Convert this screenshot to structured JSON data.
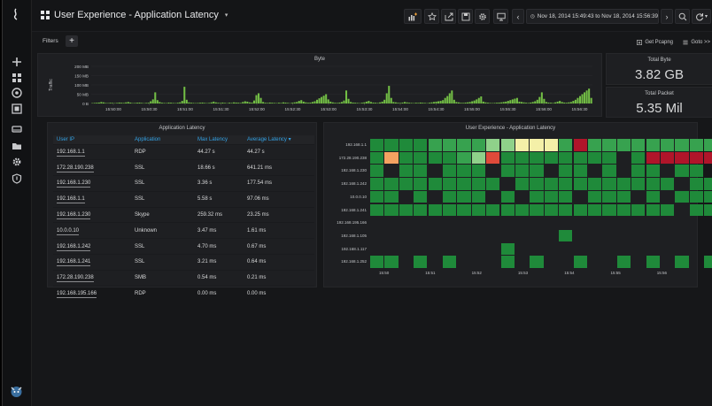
{
  "header": {
    "title": "User Experience - Application Latency",
    "time_range": "Nov 18, 2014 15:49:43 to Nov 18, 2014 15:56:39"
  },
  "filters": {
    "label": "Filters",
    "add_label": "+"
  },
  "actions": {
    "pcap_label": "Get Pcapng",
    "goto_label": "Goto >>"
  },
  "byte_panel": {
    "title": "Byte",
    "y_axis_label": "Traffic",
    "y_ticks": [
      "200 MB",
      "150 MB",
      "100 MB",
      "50 MB",
      "0 B"
    ],
    "x_ticks": [
      "15:50:00",
      "15:50:30",
      "15:51:00",
      "15:51:30",
      "15:52:00",
      "15:52:30",
      "15:53:00",
      "15:53:30",
      "15:54:00",
      "15:54:30",
      "15:55:00",
      "15:55:30",
      "15:56:00",
      "15:56:30"
    ]
  },
  "chart_data": {
    "type": "bar",
    "title": "Byte",
    "ylabel": "Traffic",
    "ylim": [
      0,
      200
    ],
    "unit": "MB",
    "x_range": [
      "15:49:43",
      "15:56:39"
    ],
    "values": [
      2,
      3,
      4,
      5,
      8,
      6,
      3,
      2,
      4,
      3,
      2,
      3,
      5,
      4,
      3,
      6,
      8,
      5,
      2,
      3,
      4,
      5,
      3,
      2,
      3,
      4,
      12,
      22,
      60,
      18,
      8,
      4,
      3,
      2,
      5,
      4,
      3,
      2,
      4,
      6,
      14,
      90,
      20,
      6,
      4,
      3,
      2,
      3,
      4,
      5,
      3,
      2,
      3,
      6,
      10,
      6,
      4,
      3,
      5,
      3,
      2,
      4,
      3,
      6,
      5,
      4,
      3,
      8,
      12,
      10,
      6,
      5,
      16,
      45,
      55,
      30,
      8,
      4,
      3,
      5,
      4,
      3,
      2,
      4,
      3,
      6,
      5,
      3,
      2,
      4,
      6,
      8,
      14,
      18,
      10,
      6,
      4,
      5,
      8,
      12,
      20,
      28,
      35,
      42,
      50,
      22,
      10,
      6,
      4,
      3,
      5,
      8,
      16,
      70,
      25,
      8,
      5,
      4,
      3,
      2,
      4,
      6,
      10,
      14,
      8,
      5,
      4,
      3,
      6,
      10,
      20,
      55,
      95,
      30,
      8,
      6,
      4,
      3,
      5,
      8,
      6,
      4,
      3,
      2,
      4,
      3,
      5,
      4,
      3,
      2,
      4,
      6,
      8,
      10,
      12,
      14,
      18,
      30,
      40,
      55,
      70,
      20,
      8,
      6,
      4,
      3,
      5,
      6,
      8,
      12,
      16,
      22,
      30,
      38,
      10,
      6,
      4,
      3,
      2,
      3,
      4,
      5,
      6,
      8,
      10,
      14,
      18,
      22,
      26,
      30,
      10,
      8,
      6,
      4,
      3,
      5,
      8,
      12,
      20,
      35,
      60,
      25,
      8,
      5,
      4,
      3,
      6,
      10,
      14,
      8,
      5,
      4,
      6,
      8,
      14,
      20,
      30,
      40,
      50,
      60,
      70,
      80,
      30
    ]
  },
  "total_byte": {
    "title": "Total Byte",
    "value": "3.82 GB"
  },
  "total_packet": {
    "title": "Total Packet",
    "value": "5.35 Mil"
  },
  "latency_table": {
    "title": "Application Latency",
    "columns": [
      "User IP",
      "Application",
      "Max Latency",
      "Average Latency"
    ],
    "sort_indicator": "▾",
    "rows": [
      {
        "ip": "192.168.1.1",
        "app": "RDP",
        "max": "44.27 s",
        "avg": "44.27 s"
      },
      {
        "ip": "172.28.190.238",
        "app": "SSL",
        "max": "18.66 s",
        "avg": "641.21 ms"
      },
      {
        "ip": "192.168.1.230",
        "app": "SSL",
        "max": "3.36 s",
        "avg": "177.54 ms"
      },
      {
        "ip": "192.168.1.1",
        "app": "SSL",
        "max": "5.58 s",
        "avg": "97.06 ms"
      },
      {
        "ip": "192.168.1.230",
        "app": "Skype",
        "max": "259.32 ms",
        "avg": "23.25 ms"
      },
      {
        "ip": "10.0.0.10",
        "app": "Unknown",
        "max": "3.47 ms",
        "avg": "1.61 ms"
      },
      {
        "ip": "192.168.1.242",
        "app": "SSL",
        "max": "4.70 ms",
        "avg": "0.67 ms"
      },
      {
        "ip": "192.168.1.241",
        "app": "SSL",
        "max": "3.21 ms",
        "avg": "0.64 ms"
      },
      {
        "ip": "172.28.190.238",
        "app": "SMB",
        "max": "0.54 ms",
        "avg": "0.21 ms"
      },
      {
        "ip": "192.168.195.166",
        "app": "RDP",
        "max": "0.00 ms",
        "avg": "0.00 ms"
      }
    ]
  },
  "heatmap": {
    "title": "User Experience - Application Latency",
    "rows": [
      "192.168.1.1",
      "172.28.190.238",
      "192.168.1.230",
      "192.168.1.242",
      "10.0.0.10",
      "192.168.1.241",
      "192.168.195.166",
      "192.168.1.105",
      "192.168.1.117",
      "192.168.1.252"
    ],
    "x_ticks": [
      "15:50",
      "15:51",
      "15:52",
      "15:53",
      "15:54",
      "15:55",
      "15:56"
    ],
    "colors": {
      "g": "#1f8a3a",
      "G": "#37a24f",
      "l": "#8fd18a",
      "y": "#f4f0a8",
      "o": "#f4a261",
      "r": "#e04a3a",
      "R": "#b0152a"
    },
    "grid": [
      "ggggGGGGllyyyGRGGGGGGGGGyo",
      "goggggGlrgggggggg.gRRRRRRR",
      "g.gg.ggg.ggg.gg.g.gg.gg.gg",
      "ggggggggg.ggggggggggg.gggg",
      "gg.g.ggg.g.ggg.ggg.g.ggg.g",
      "ggggggggggggggggggggg.gggg",
      "..........................",
      ".............g............",
      ".........g................",
      "gg.g.g...g.g..g..g.g.g.g.."
    ]
  }
}
